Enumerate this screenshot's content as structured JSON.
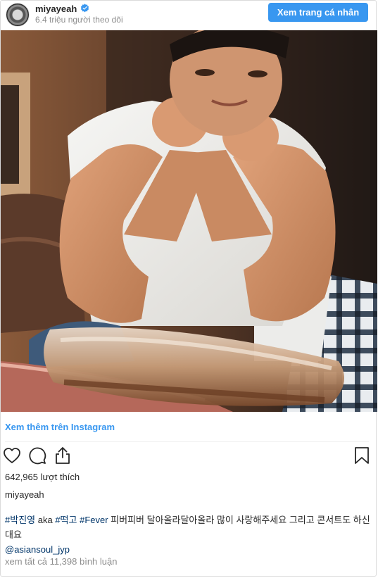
{
  "header": {
    "username": "miyayeah",
    "followers": "6.4 triệu người theo dõi",
    "profile_button": "Xem trang cá nhân"
  },
  "photo": {
    "description_icon": "post-photo"
  },
  "links": {
    "view_more": "Xem thêm trên Instagram"
  },
  "stats": {
    "likes": "642,965 lượt thích"
  },
  "caption": {
    "owner": "miyayeah",
    "hashtag1": "#박진영",
    "text1": " aka ",
    "hashtag2": "#떡고",
    "text2": " ",
    "hashtag3": "#Fever",
    "text3": " 피버피버 달아올라달아올라 많이 사랑해주세요 그리고 콘서트도 하신대요",
    "mention": "@asiansoul_jyp"
  },
  "comments": {
    "view_all": "xem tất cả 11,398 bình luận"
  },
  "colors": {
    "accent": "#3897f0",
    "link": "#003569",
    "muted": "#8e8e8e"
  }
}
